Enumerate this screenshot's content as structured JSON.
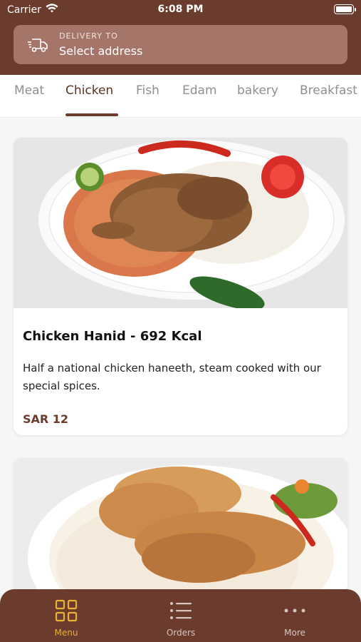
{
  "status_bar": {
    "carrier": "Carrier",
    "time": "6:08 PM"
  },
  "address": {
    "label": "DELIVERY TO",
    "value": "Select address"
  },
  "tabs": [
    {
      "label": "Meat"
    },
    {
      "label": "Chicken"
    },
    {
      "label": "Fish"
    },
    {
      "label": "Edam"
    },
    {
      "label": "bakery"
    },
    {
      "label": "Breakfast"
    }
  ],
  "active_tab": "Chicken",
  "items": [
    {
      "title": "Chicken Hanid - 692 Kcal",
      "description": "Half a national chicken haneeth, steam cooked with our special spices.",
      "price": "SAR 12"
    }
  ],
  "bottom_nav": [
    {
      "label": "Menu",
      "icon": "grid-icon",
      "active": true
    },
    {
      "label": "Orders",
      "icon": "list-icon",
      "active": false
    },
    {
      "label": "More",
      "icon": "more-dots-icon",
      "active": false
    }
  ],
  "colors": {
    "brand": "#6b3b2e",
    "accent": "#e7b236",
    "address_bg": "#a57569"
  }
}
